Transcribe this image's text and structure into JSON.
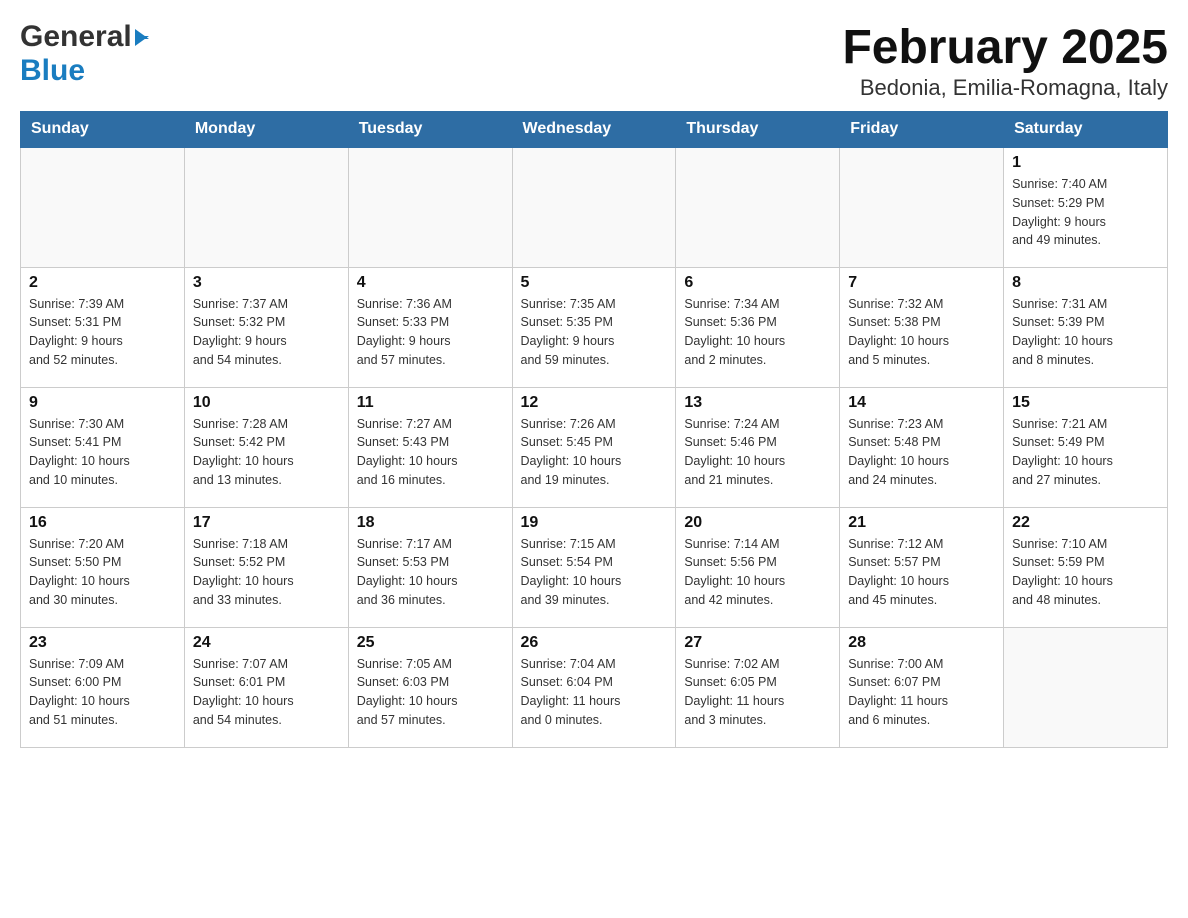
{
  "header": {
    "month_title": "February 2025",
    "location": "Bedonia, Emilia-Romagna, Italy",
    "logo_general": "General",
    "logo_blue": "Blue"
  },
  "days_of_week": [
    "Sunday",
    "Monday",
    "Tuesday",
    "Wednesday",
    "Thursday",
    "Friday",
    "Saturday"
  ],
  "weeks": [
    [
      {
        "day": "",
        "info": ""
      },
      {
        "day": "",
        "info": ""
      },
      {
        "day": "",
        "info": ""
      },
      {
        "day": "",
        "info": ""
      },
      {
        "day": "",
        "info": ""
      },
      {
        "day": "",
        "info": ""
      },
      {
        "day": "1",
        "info": "Sunrise: 7:40 AM\nSunset: 5:29 PM\nDaylight: 9 hours\nand 49 minutes."
      }
    ],
    [
      {
        "day": "2",
        "info": "Sunrise: 7:39 AM\nSunset: 5:31 PM\nDaylight: 9 hours\nand 52 minutes."
      },
      {
        "day": "3",
        "info": "Sunrise: 7:37 AM\nSunset: 5:32 PM\nDaylight: 9 hours\nand 54 minutes."
      },
      {
        "day": "4",
        "info": "Sunrise: 7:36 AM\nSunset: 5:33 PM\nDaylight: 9 hours\nand 57 minutes."
      },
      {
        "day": "5",
        "info": "Sunrise: 7:35 AM\nSunset: 5:35 PM\nDaylight: 9 hours\nand 59 minutes."
      },
      {
        "day": "6",
        "info": "Sunrise: 7:34 AM\nSunset: 5:36 PM\nDaylight: 10 hours\nand 2 minutes."
      },
      {
        "day": "7",
        "info": "Sunrise: 7:32 AM\nSunset: 5:38 PM\nDaylight: 10 hours\nand 5 minutes."
      },
      {
        "day": "8",
        "info": "Sunrise: 7:31 AM\nSunset: 5:39 PM\nDaylight: 10 hours\nand 8 minutes."
      }
    ],
    [
      {
        "day": "9",
        "info": "Sunrise: 7:30 AM\nSunset: 5:41 PM\nDaylight: 10 hours\nand 10 minutes."
      },
      {
        "day": "10",
        "info": "Sunrise: 7:28 AM\nSunset: 5:42 PM\nDaylight: 10 hours\nand 13 minutes."
      },
      {
        "day": "11",
        "info": "Sunrise: 7:27 AM\nSunset: 5:43 PM\nDaylight: 10 hours\nand 16 minutes."
      },
      {
        "day": "12",
        "info": "Sunrise: 7:26 AM\nSunset: 5:45 PM\nDaylight: 10 hours\nand 19 minutes."
      },
      {
        "day": "13",
        "info": "Sunrise: 7:24 AM\nSunset: 5:46 PM\nDaylight: 10 hours\nand 21 minutes."
      },
      {
        "day": "14",
        "info": "Sunrise: 7:23 AM\nSunset: 5:48 PM\nDaylight: 10 hours\nand 24 minutes."
      },
      {
        "day": "15",
        "info": "Sunrise: 7:21 AM\nSunset: 5:49 PM\nDaylight: 10 hours\nand 27 minutes."
      }
    ],
    [
      {
        "day": "16",
        "info": "Sunrise: 7:20 AM\nSunset: 5:50 PM\nDaylight: 10 hours\nand 30 minutes."
      },
      {
        "day": "17",
        "info": "Sunrise: 7:18 AM\nSunset: 5:52 PM\nDaylight: 10 hours\nand 33 minutes."
      },
      {
        "day": "18",
        "info": "Sunrise: 7:17 AM\nSunset: 5:53 PM\nDaylight: 10 hours\nand 36 minutes."
      },
      {
        "day": "19",
        "info": "Sunrise: 7:15 AM\nSunset: 5:54 PM\nDaylight: 10 hours\nand 39 minutes."
      },
      {
        "day": "20",
        "info": "Sunrise: 7:14 AM\nSunset: 5:56 PM\nDaylight: 10 hours\nand 42 minutes."
      },
      {
        "day": "21",
        "info": "Sunrise: 7:12 AM\nSunset: 5:57 PM\nDaylight: 10 hours\nand 45 minutes."
      },
      {
        "day": "22",
        "info": "Sunrise: 7:10 AM\nSunset: 5:59 PM\nDaylight: 10 hours\nand 48 minutes."
      }
    ],
    [
      {
        "day": "23",
        "info": "Sunrise: 7:09 AM\nSunset: 6:00 PM\nDaylight: 10 hours\nand 51 minutes."
      },
      {
        "day": "24",
        "info": "Sunrise: 7:07 AM\nSunset: 6:01 PM\nDaylight: 10 hours\nand 54 minutes."
      },
      {
        "day": "25",
        "info": "Sunrise: 7:05 AM\nSunset: 6:03 PM\nDaylight: 10 hours\nand 57 minutes."
      },
      {
        "day": "26",
        "info": "Sunrise: 7:04 AM\nSunset: 6:04 PM\nDaylight: 11 hours\nand 0 minutes."
      },
      {
        "day": "27",
        "info": "Sunrise: 7:02 AM\nSunset: 6:05 PM\nDaylight: 11 hours\nand 3 minutes."
      },
      {
        "day": "28",
        "info": "Sunrise: 7:00 AM\nSunset: 6:07 PM\nDaylight: 11 hours\nand 6 minutes."
      },
      {
        "day": "",
        "info": ""
      }
    ]
  ]
}
